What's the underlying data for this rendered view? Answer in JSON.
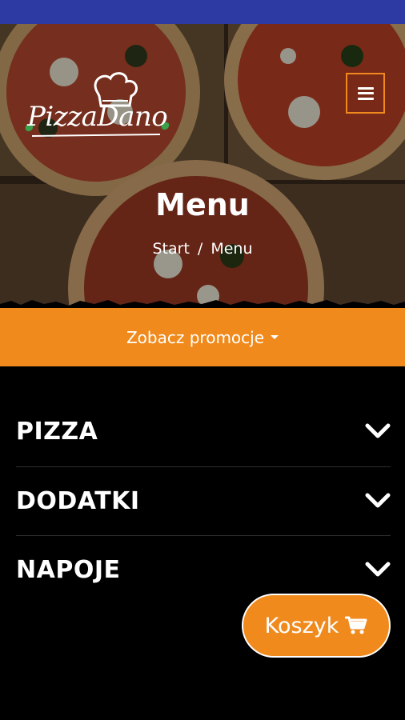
{
  "brand": {
    "logo_text": "PizzaDano"
  },
  "header": {
    "menu_icon": "hamburger-icon",
    "title": "Menu",
    "breadcrumb": {
      "home": "Start",
      "separator": "/",
      "current": "Menu"
    }
  },
  "promo": {
    "label": "Zobacz promocje",
    "icon": "caret-down-icon"
  },
  "categories": [
    {
      "label": "PIZZA",
      "icon": "chevron-down-icon"
    },
    {
      "label": "DODATKI",
      "icon": "chevron-down-icon"
    },
    {
      "label": "NAPOJE",
      "icon": "chevron-down-icon"
    }
  ],
  "cart": {
    "label": "Koszyk",
    "icon": "cart-icon"
  },
  "colors": {
    "accent": "#f08a1c",
    "status_bar": "#2e3aa4",
    "background": "#000000"
  }
}
